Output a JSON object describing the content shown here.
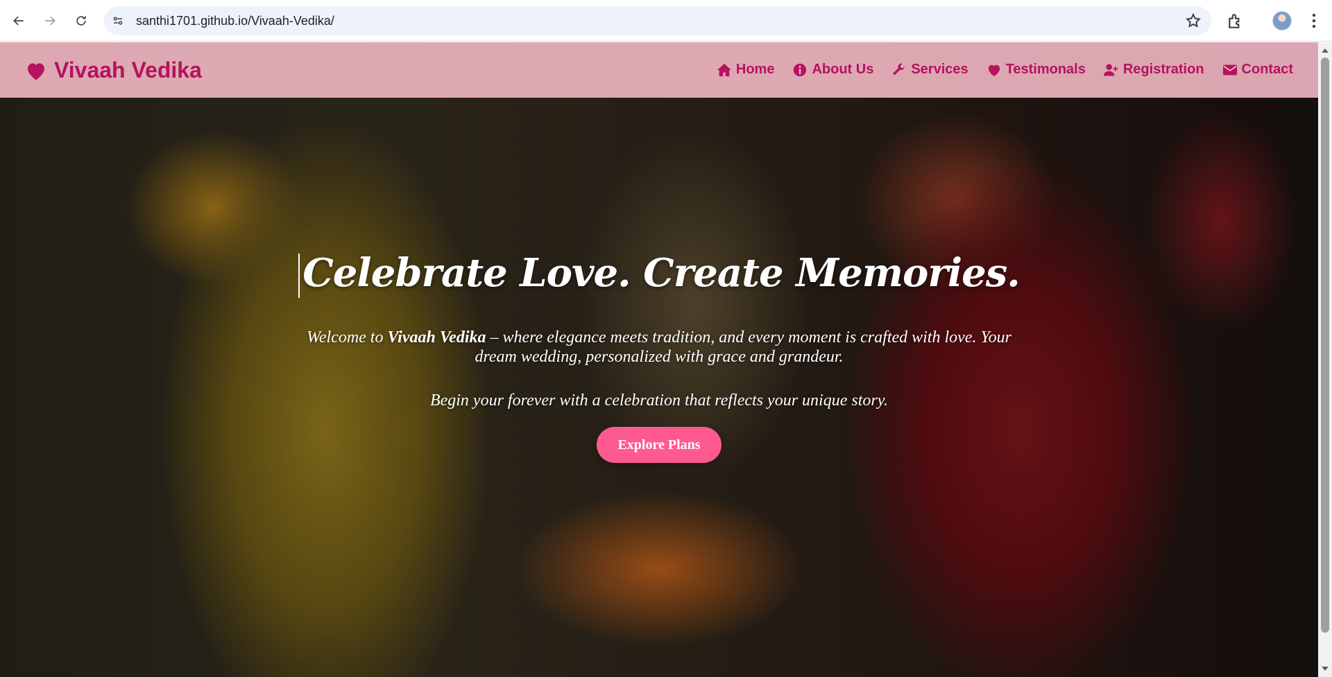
{
  "browser": {
    "url": "santhi1701.github.io/Vivaah-Vedika/"
  },
  "site": {
    "brand": "Vivaah Vedika",
    "brand_color": "#b5125f",
    "nav": [
      {
        "label": "Home",
        "icon": "home-icon"
      },
      {
        "label": "About Us",
        "icon": "info-circle-icon"
      },
      {
        "label": "Services",
        "icon": "wrench-icon"
      },
      {
        "label": "Testimonals",
        "icon": "heart-icon"
      },
      {
        "label": "Registration",
        "icon": "user-plus-icon"
      },
      {
        "label": "Contact",
        "icon": "envelope-icon"
      }
    ]
  },
  "hero": {
    "title": "Celebrate Love. Create Memories.",
    "intro_prefix": "Welcome to ",
    "intro_brand": "Vivaah Vedika",
    "intro_suffix": " – where elegance meets tradition, and every moment is crafted with love. Your dream wedding, personalized with grace and grandeur.",
    "tagline": "Begin your forever with a celebration that reflects your unique story.",
    "cta_label": "Explore Plans",
    "cta_color": "#ff5a8f"
  }
}
